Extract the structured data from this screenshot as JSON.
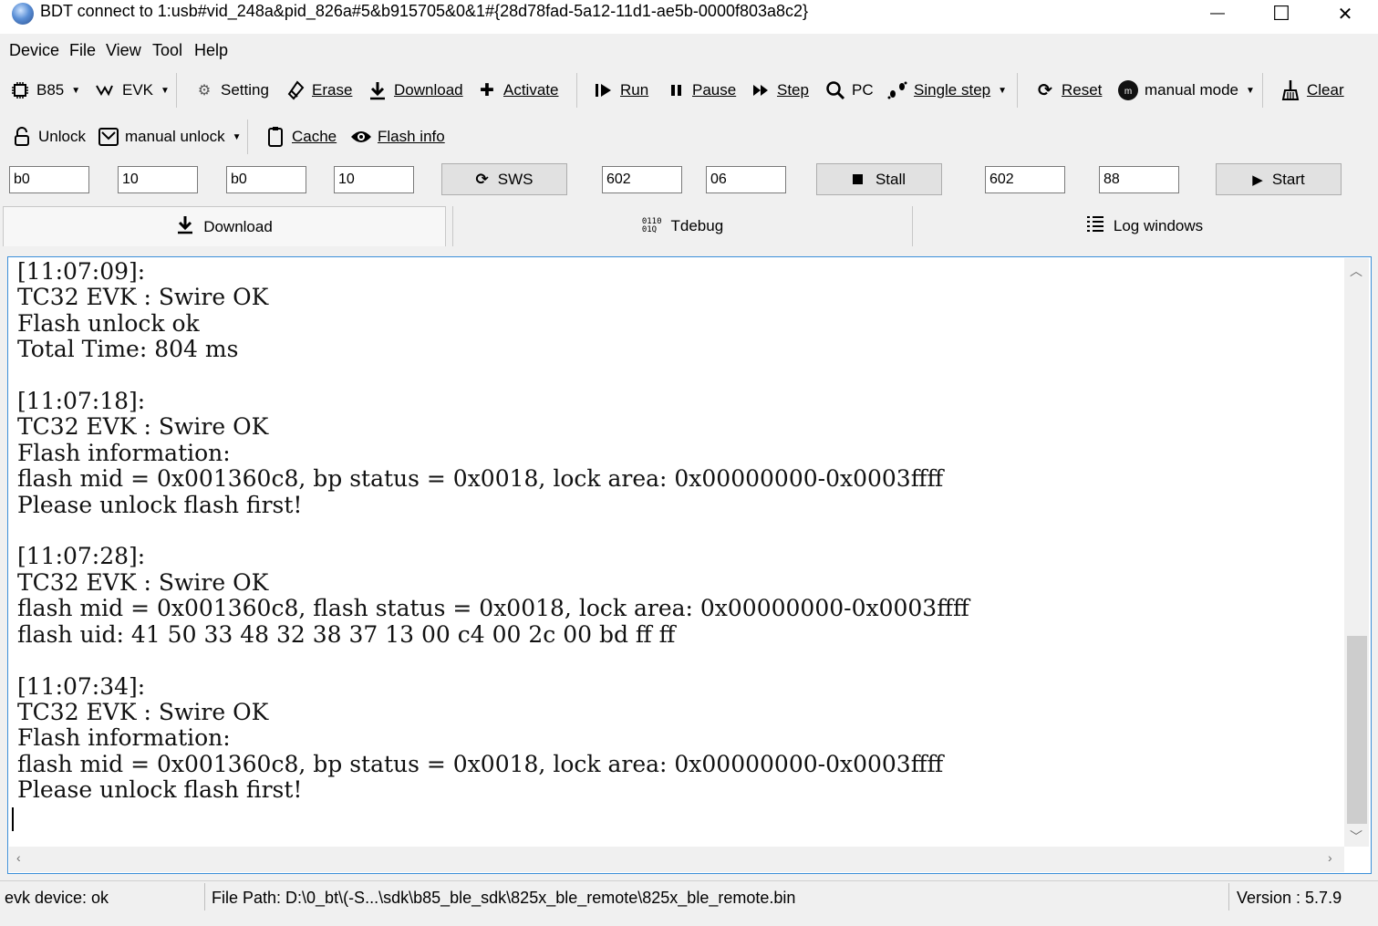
{
  "window": {
    "title": "BDT connect to 1:usb#vid_248a&pid_826a#5&b915705&0&1#{28d78fad-5a12-11d1-ae5b-0000f803a8c2}",
    "minimize": "—",
    "maximize": "☐",
    "close": "✕"
  },
  "menu": [
    "Device",
    "File",
    "View",
    "Tool",
    "Help"
  ],
  "toolbar1": {
    "chip": "B85",
    "evk": "EVK",
    "setting": "Setting",
    "erase": "Erase",
    "download": "Download",
    "activate": "Activate",
    "run": "Run",
    "pause": "Pause",
    "step": "Step",
    "pc": "PC",
    "single_step": "Single step",
    "reset": "Reset",
    "manual_mode": "manual mode",
    "clear": "Clear"
  },
  "toolbar2": {
    "unlock": "Unlock",
    "manual_unlock": "manual unlock",
    "cache": "Cache",
    "flash_info": "Flash info"
  },
  "fields": {
    "f1": "b0",
    "f2": "10",
    "f3": "b0",
    "f4": "10",
    "sws": "SWS",
    "f5": "602",
    "f6": "06",
    "stall": "Stall",
    "f7": "602",
    "f8": "88",
    "start": "Start"
  },
  "tabs": [
    "Download",
    "Tdebug",
    "Log windows"
  ],
  "log": [
    "[11:07:09]:",
    "TC32 EVK : Swire OK",
    "Flash unlock ok",
    "Total Time: 804 ms",
    "",
    "[11:07:18]:",
    "TC32 EVK : Swire OK",
    "Flash information:",
    "flash mid = 0x001360c8, bp status = 0x0018, lock area: 0x00000000-0x0003ffff",
    "Please unlock flash first!",
    "",
    "[11:07:28]:",
    "TC32 EVK : Swire OK",
    "flash mid = 0x001360c8, flash status = 0x0018, lock area: 0x00000000-0x0003ffff",
    "flash uid: 41 50 33 48 32 38 37 13 00 c4 00 2c 00 bd ff ff",
    "",
    "[11:07:34]:",
    "TC32 EVK : Swire OK",
    "Flash information:",
    "flash mid = 0x001360c8, bp status = 0x0018, lock area: 0x00000000-0x0003ffff",
    "Please unlock flash first!"
  ],
  "status": {
    "device": "evk device: ok",
    "file_path": "File Path:  D:\\0_bt\\(-S...\\sdk\\b85_ble_sdk\\825x_ble_remote\\825x_ble_remote.bin",
    "version": "Version : 5.7.9"
  },
  "colors": {
    "accent": "#3b8fd9",
    "button_bg": "#e1e1e1",
    "chrome_bg": "#f0f0f0"
  }
}
